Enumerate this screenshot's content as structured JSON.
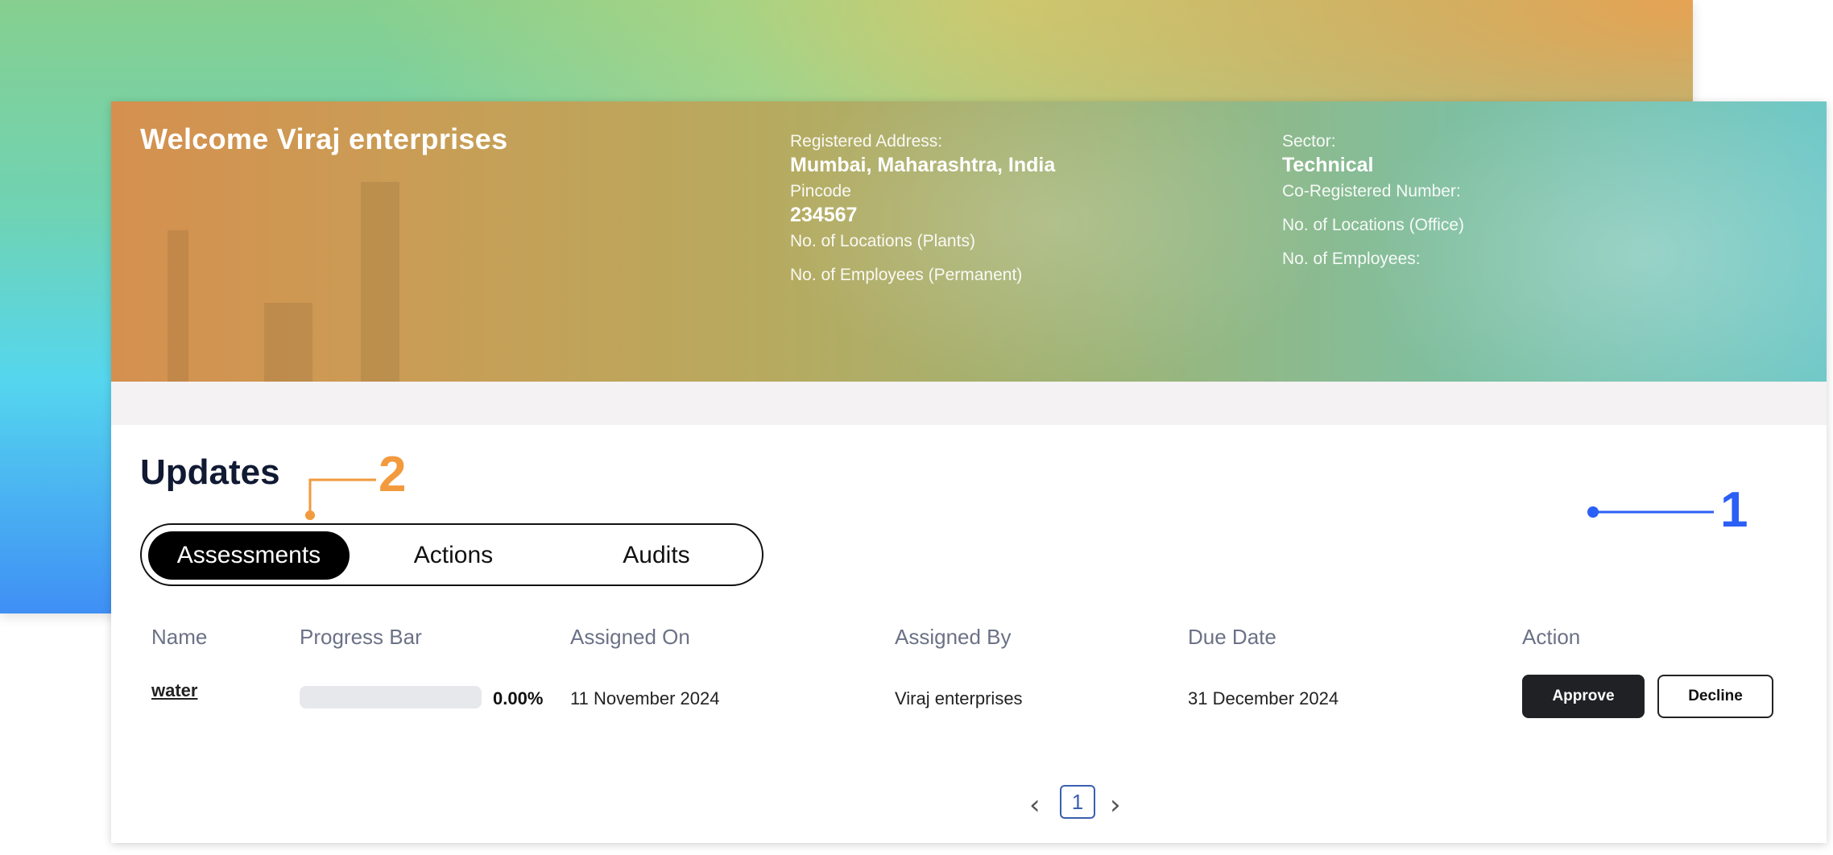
{
  "hero": {
    "welcome": "Welcome Viraj enterprises",
    "col1": {
      "registered_address_label": "Registered Address:",
      "registered_address_value": "Mumbai, Maharashtra, India",
      "pincode_label": "Pincode",
      "pincode_value": "234567",
      "locations_plants_label": "No. of Locations (Plants)",
      "employees_permanent_label": "No. of Employees (Permanent)"
    },
    "col2": {
      "sector_label": "Sector:",
      "sector_value": "Technical",
      "co_registered_label": "Co-Registered Number:",
      "locations_office_label": "No. of Locations (Office)",
      "employees_label": "No. of Employees:"
    }
  },
  "updates": {
    "title": "Updates",
    "tabs": [
      {
        "label": "Assessments",
        "active": true
      },
      {
        "label": "Actions",
        "active": false
      },
      {
        "label": "Audits",
        "active": false
      }
    ]
  },
  "table": {
    "headers": [
      "Name",
      "Progress Bar",
      "Assigned On",
      "Assigned By",
      "Due Date",
      "Action"
    ],
    "rows": [
      {
        "name": "water",
        "progress_text": "0.00%",
        "progress_fraction": 0.0,
        "assigned_on": "11 November 2024",
        "assigned_by": "Viraj enterprises",
        "due_date": "31 December 2024",
        "approve_label": "Approve",
        "decline_label": "Decline"
      }
    ]
  },
  "pagination": {
    "prev_icon": "‹",
    "current_page": "1",
    "next_icon": "›"
  },
  "annotations": {
    "marker_1": "1",
    "marker_2": "2",
    "marker_1_color": "#2b5ff5",
    "marker_2_color": "#f29a3d"
  }
}
